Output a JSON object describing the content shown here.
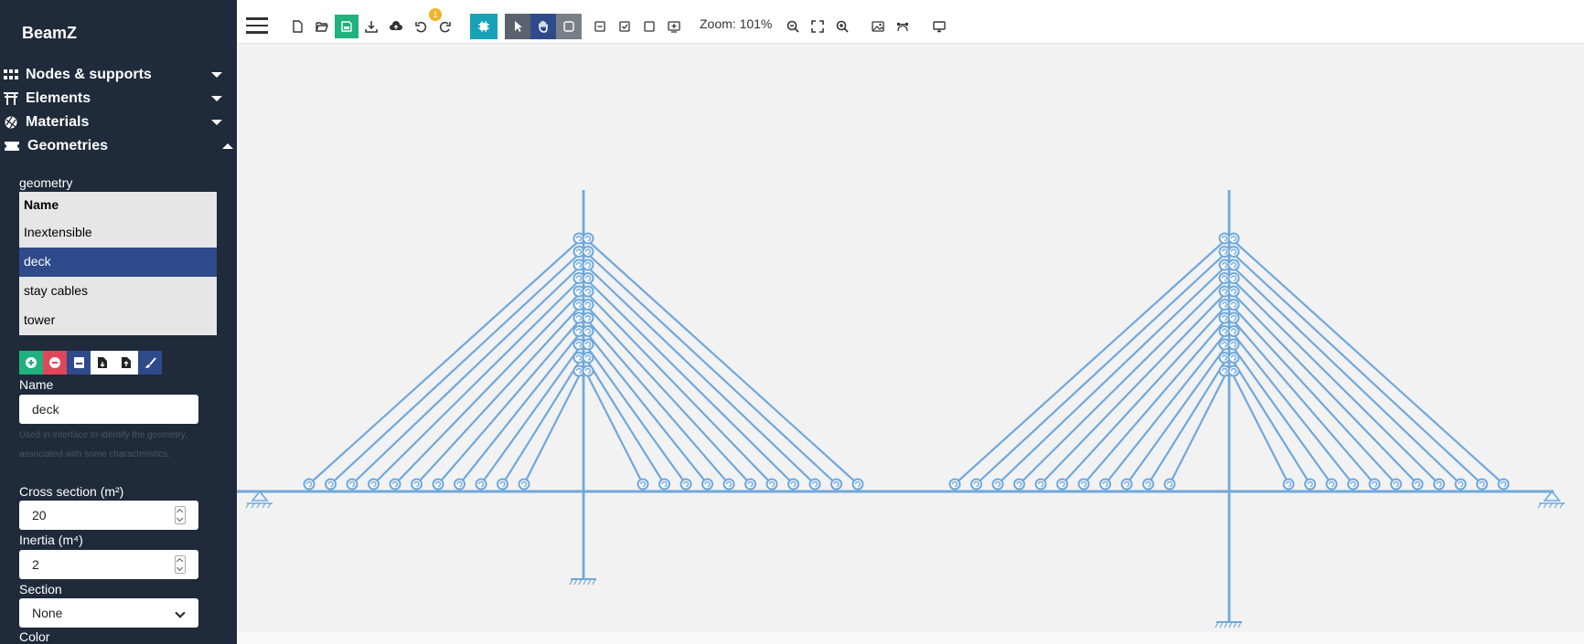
{
  "app": {
    "title": "BeamZ"
  },
  "sidebar": {
    "sections": [
      {
        "label": "Nodes & supports",
        "icon": "grid-icon",
        "expanded": false
      },
      {
        "label": "Elements",
        "icon": "torii-gate-icon",
        "expanded": false
      },
      {
        "label": "Materials",
        "icon": "texture-ball-icon",
        "expanded": false
      },
      {
        "label": "Geometries",
        "icon": "ticket-icon",
        "expanded": true
      }
    ],
    "geometry_label": "geometry",
    "list": {
      "header": "Name",
      "items": [
        "Inextensible",
        "deck",
        "stay cables",
        "tower"
      ],
      "selected": "deck"
    },
    "actions": [
      "add-icon",
      "remove-icon",
      "save-icon",
      "import-file-icon",
      "export-file-icon",
      "brush-icon"
    ],
    "form": {
      "name_label": "Name",
      "name_value": "deck",
      "name_hint": "Used in interface to identify the geometry, associated with some characteristics.",
      "cross_section_label": "Cross section (m²)",
      "cross_section_value": "20",
      "inertia_label": "Inertia (m⁴)",
      "inertia_value": "2",
      "section_label": "Section",
      "section_value": "None",
      "color_label": "Color"
    }
  },
  "toolbar": {
    "undo_badge": "1",
    "zoom_text": "Zoom: 101%"
  },
  "colors": {
    "sidebar_bg": "#1f2a3a",
    "structure": "#6fa8dc",
    "save_green": "#20b27c",
    "remove_red": "#e04658",
    "selection_blue": "#2f4a8a",
    "teal": "#17a2b8"
  }
}
